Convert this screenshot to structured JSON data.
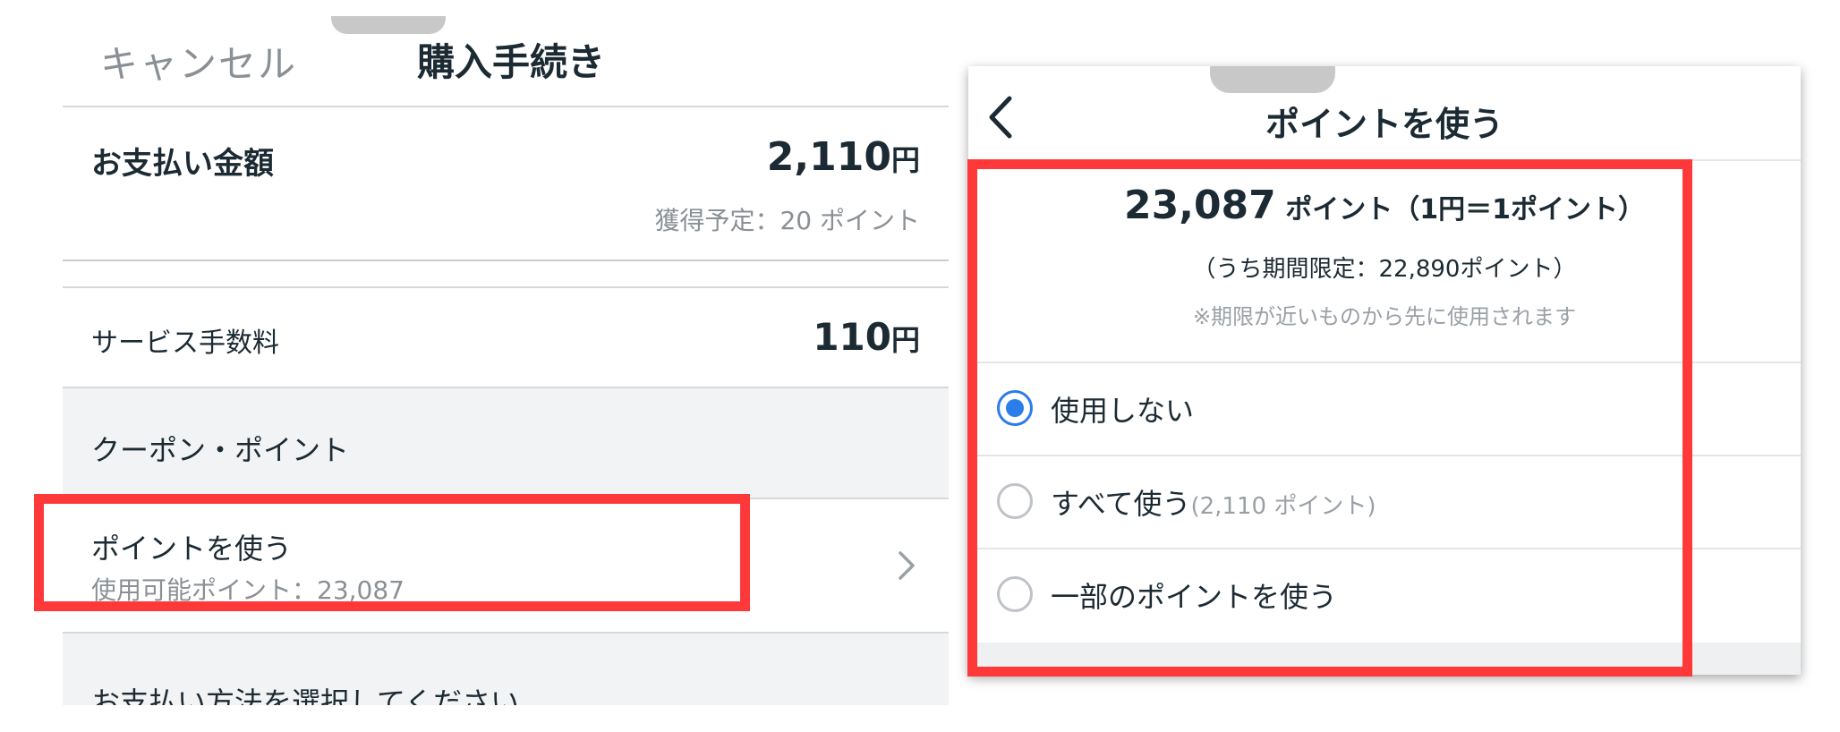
{
  "left": {
    "cancel_label": "キャンセル",
    "title": "購入手続き",
    "payment": {
      "label": "お支払い金額",
      "amount": "2,110",
      "currency": "円",
      "earn_note": "獲得予定：20 ポイント"
    },
    "fee": {
      "label": "サービス手数料",
      "amount": "110",
      "currency": "円"
    },
    "coupon_section": "クーポン・ポイント",
    "use_points": {
      "label": "ポイントを使う",
      "available": "使用可能ポイント：23,087"
    },
    "payment_method": "お支払い方法を選択してください"
  },
  "right": {
    "title": "ポイントを使う",
    "points_num": "23,087",
    "points_suffix": " ポイント（1円＝1ポイント）",
    "limited": "（うち期間限定：22,890ポイント）",
    "note": "※期限が近いものから先に使用されます",
    "options": [
      {
        "label": "使用しない",
        "sub": "",
        "selected": true
      },
      {
        "label": "すべて使う",
        "sub": "(2,110 ポイント)",
        "selected": false
      },
      {
        "label": "一部のポイントを使う",
        "sub": "",
        "selected": false
      }
    ]
  },
  "colors": {
    "accent_blue": "#2b7de9",
    "highlight_red": "#ff3939",
    "text_dark": "#1b2a33",
    "text_gray": "#8a9096"
  }
}
